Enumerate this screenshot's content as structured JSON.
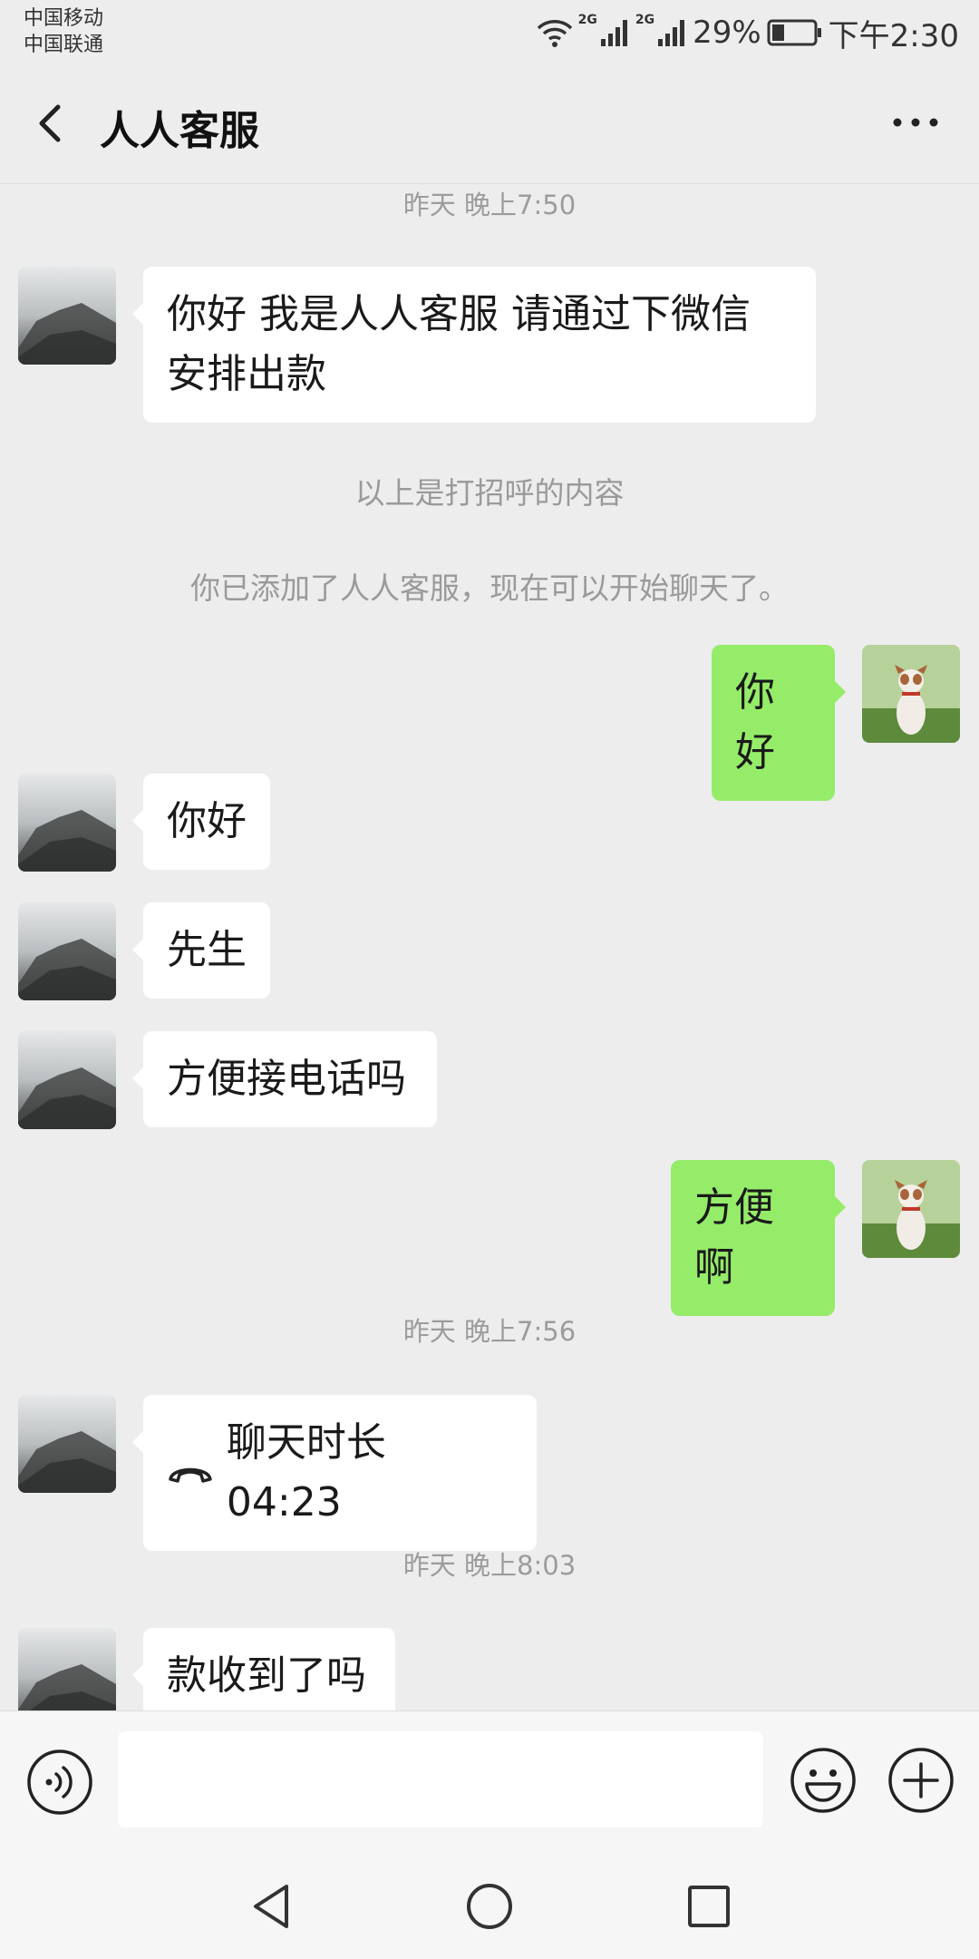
{
  "status_bar": {
    "carrier1": "中国移动",
    "carrier2": "中国联通",
    "net1": "2G",
    "net2": "2G",
    "battery": "29%",
    "time": "下午2:30",
    "battery_level": 0.29
  },
  "header": {
    "title": "人人客服",
    "back_icon": "chevron-left-icon",
    "more_icon": "more-dots-icon"
  },
  "chat": {
    "time1": "昨天 晚上7:50",
    "msg_greeting_line1": "你好  我是人人客服 请通过下微信",
    "msg_greeting_line2": "安排出款",
    "sys_greeting_note": "以上是打招呼的内容",
    "sys_added_note": "你已添加了人人客服，现在可以开始聊天了。",
    "msg_out_hello": "你好",
    "msg_in_hello": "你好",
    "msg_in_sir": "先生",
    "msg_in_call": "方便接电话吗",
    "msg_out_ok": "方便啊",
    "time2": "昨天 晚上7:56",
    "call_duration": "聊天时长 04:23",
    "time3": "昨天 晚上8:03",
    "msg_in_received": "款收到了吗"
  },
  "input_bar": {
    "value": "",
    "voice_icon": "voice-icon",
    "emoji_icon": "emoji-icon",
    "plus_icon": "plus-icon"
  },
  "nav": {
    "back_icon": "triangle-back-icon",
    "home_icon": "circle-home-icon",
    "recent_icon": "square-recent-icon"
  },
  "colors": {
    "background": "#ededed",
    "bubble_out": "#95ec69",
    "bubble_in": "#ffffff"
  }
}
